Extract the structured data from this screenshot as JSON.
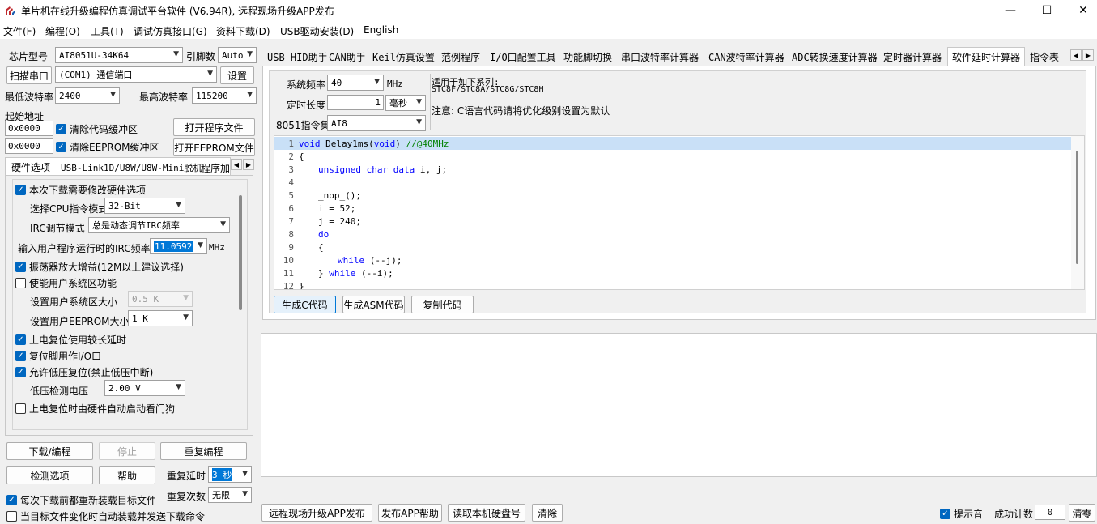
{
  "window": {
    "title": "单片机在线升级编程仿真调试平台软件 (V6.94R), 远程现场升级APP发布",
    "minimize": "—",
    "maximize": "☐",
    "close": "✕"
  },
  "menu": [
    "文件(F)",
    "编程(O)",
    "工具(T)",
    "调试仿真接口(G)",
    "资料下载(D)",
    "USB驱动安装(D)",
    "English"
  ],
  "left": {
    "chip_label": "芯片型号",
    "chip_value": "AI8051U-34K64",
    "pins_label": "引脚数",
    "pins_value": "Auto",
    "scan_port": "扫描串口",
    "port_value": "(COM1) 通信端口",
    "settings": "设置",
    "min_baud_label": "最低波特率",
    "min_baud_value": "2400",
    "max_baud_label": "最高波特率",
    "max_baud_value": "115200",
    "start_addr_label": "起始地址",
    "addr1": "0x0000",
    "clear_code": "清除代码缓冲区",
    "open_prog": "打开程序文件",
    "addr2": "0x0000",
    "clear_eeprom": "清除EEPROM缓冲区",
    "open_eeprom": "打开EEPROM文件",
    "tabs": [
      "硬件选项",
      "USB-Link1D/U8W/U8W-Mini脱机",
      "程序加"
    ],
    "hw": {
      "modify_hw": "本次下载需要修改硬件选项",
      "cpu_mode_label": "选择CPU指令模式",
      "cpu_mode_value": "32-Bit",
      "irc_label": "IRC调节模式",
      "irc_value": "总是动态调节IRC频率",
      "freq_label": "输入用户程序运行时的IRC频率",
      "freq_value": "11.0592",
      "freq_unit": "MHz",
      "osc_gain": "振荡器放大增益(12M以上建议选择)",
      "user_sys": "使能用户系统区功能",
      "sys_size_label": "设置用户系统区大小",
      "sys_size_value": "0.5 K",
      "eeprom_size_label": "设置用户EEPROM大小",
      "eeprom_size_value": "1   K",
      "long_delay": "上电复位使用较长延时",
      "reset_io": "复位脚用作I/O口",
      "low_volt_reset": "允许低压复位(禁止低压中断)",
      "low_volt_label": "低压检测电压",
      "low_volt_value": "2.00 V",
      "watchdog": "上电复位时由硬件自动启动看门狗"
    },
    "download": "下载/编程",
    "stop": "停止",
    "reprogram": "重复编程",
    "detect": "检测选项",
    "help": "帮助",
    "repeat_delay_label": "重复延时",
    "repeat_delay_value": "3 秒",
    "repeat_count_label": "重复次数",
    "repeat_count_value": "无限",
    "reload_each": "每次下载前都重新装载目标文件",
    "auto_load": "当目标文件变化时自动装载并发送下载命令"
  },
  "right_tabs": [
    "USB-HID助手",
    "CAN助手",
    "Keil仿真设置",
    "范例程序",
    "I/O口配置工具",
    "功能脚切换",
    "串口波特率计算器",
    "CAN波特率计算器",
    "ADC转换速度计算器",
    "定时器计算器",
    "软件延时计算器",
    "指令表"
  ],
  "delay": {
    "freq_label": "系统频率",
    "freq_value": "40",
    "freq_unit": "MHz",
    "len_label": "定时长度",
    "len_value": "1",
    "len_unit": "毫秒",
    "isa_label": "8051指令集",
    "isa_value": "AI8",
    "applies_label": "适用于如下系列:",
    "applies_series": "STC8F/STC8A/STC8G/STC8H",
    "note": "注意: C语言代码请将优化级别设置为默认"
  },
  "code": {
    "line_numbers": [
      "1",
      "2",
      "3",
      "4",
      "5",
      "6",
      "7",
      "8",
      "9",
      "10",
      "11",
      "12"
    ],
    "l1_kw": "void",
    "l1_rest": " Delay1ms(",
    "l1_kw2": "void",
    "l1_close": ") ",
    "l1_comment": "//@40MHz",
    "l2": "{",
    "l3_kw": "unsigned char data",
    "l3_rest": " i, j;",
    "l4": "",
    "l5": "_nop_();",
    "l6": "i = 52;",
    "l7": "j = 240;",
    "l8_kw": "do",
    "l9": "{",
    "l10_kw": "while",
    "l10_rest": " (--j);",
    "l11_pre": "} ",
    "l11_kw": "while",
    "l11_rest": " (--i);",
    "l12": "}"
  },
  "code_buttons": [
    "生成C代码",
    "生成ASM代码",
    "复制代码"
  ],
  "bottom": {
    "remote_publish": "远程现场升级APP发布",
    "publish_help": "发布APP帮助",
    "read_disk": "读取本机硬盘号",
    "clear": "清除",
    "beep": "提示音",
    "success_count_label": "成功计数",
    "success_count_value": "0",
    "reset_count": "清零"
  },
  "colors": {
    "accent": "#0067c0",
    "code_highlight": "#c9e0f7",
    "keyword": "#0000ff",
    "comment": "#008000"
  }
}
